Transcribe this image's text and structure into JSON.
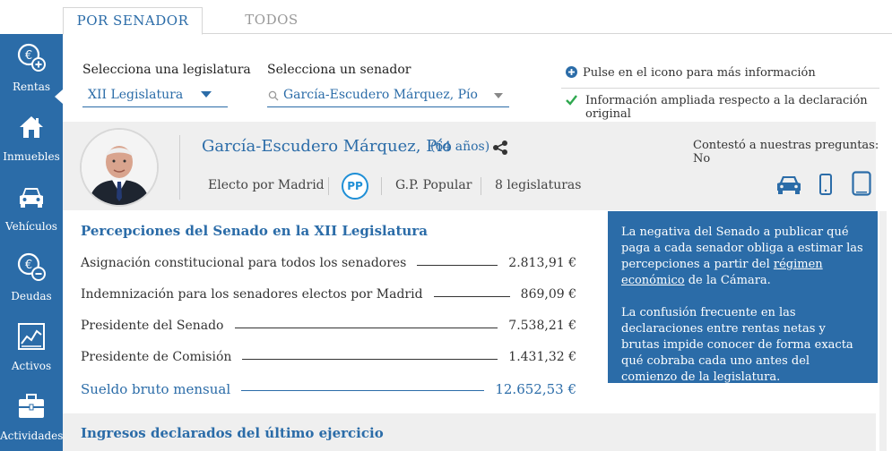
{
  "tabs": [
    {
      "label": "POR SENADOR",
      "active": true
    },
    {
      "label": "TODOS",
      "active": false
    }
  ],
  "sidebar": {
    "items": [
      {
        "label": "Rentas",
        "icon": "euro-plus-icon",
        "active": true
      },
      {
        "label": "Inmuebles",
        "icon": "house-icon"
      },
      {
        "label": "Vehículos",
        "icon": "car-icon"
      },
      {
        "label": "Deudas",
        "icon": "euro-minus-icon"
      },
      {
        "label": "Activos",
        "icon": "chart-icon"
      },
      {
        "label": "Actividades",
        "icon": "briefcase-icon"
      }
    ]
  },
  "filters": {
    "legislature_label": "Selecciona una legislatura",
    "legislature_value": "XII Legislatura",
    "senator_label": "Selecciona un senador",
    "senator_value": "García-Escudero Márquez, Pío"
  },
  "info": {
    "plus_hint": "Pulse en el icono para más información",
    "check_hint": "Información ampliada respecto a la declaración original"
  },
  "senator": {
    "name": "García-Escudero Márquez, Pío",
    "age": "(64 años)",
    "elected": "Electo por Madrid",
    "party_logo": "PP",
    "group": "G.P. Popular",
    "legislatures": "8 legislaturas",
    "answered": "Contestó a nuestras preguntas: No"
  },
  "perceptions": {
    "title": "Percepciones del Senado en la XII Legislatura",
    "rows": [
      {
        "label": "Asignación constitucional para todos los senadores",
        "value": "2.813,91 €"
      },
      {
        "label": "Indemnización para los senadores electos por Madrid",
        "value": "869,09 €"
      },
      {
        "label": "Presidente del Senado",
        "value": "7.538,21 €"
      },
      {
        "label": "Presidente de Comisión",
        "value": "1.431,32 €"
      }
    ],
    "total_label": "Sueldo bruto mensual",
    "total_value": "12.652,53 €"
  },
  "note": {
    "p1_before": "La negativa del Senado a publicar qué paga a cada senador obliga a estimar las percepciones a partir del ",
    "p1_link": "régimen económico",
    "p1_after": " de la Cámara.",
    "p2": "La confusión frecuente en las declaraciones entre rentas netas y brutas impide conocer de forma exacta qué cobraba cada uno antes del comienzo de la legislatura."
  },
  "income": {
    "title": "Ingresos declarados del último ejercicio"
  },
  "colors": {
    "brand_blue": "#2b6ca8",
    "check_green": "#2fa84f",
    "pp_blue": "#1f8fd6"
  }
}
